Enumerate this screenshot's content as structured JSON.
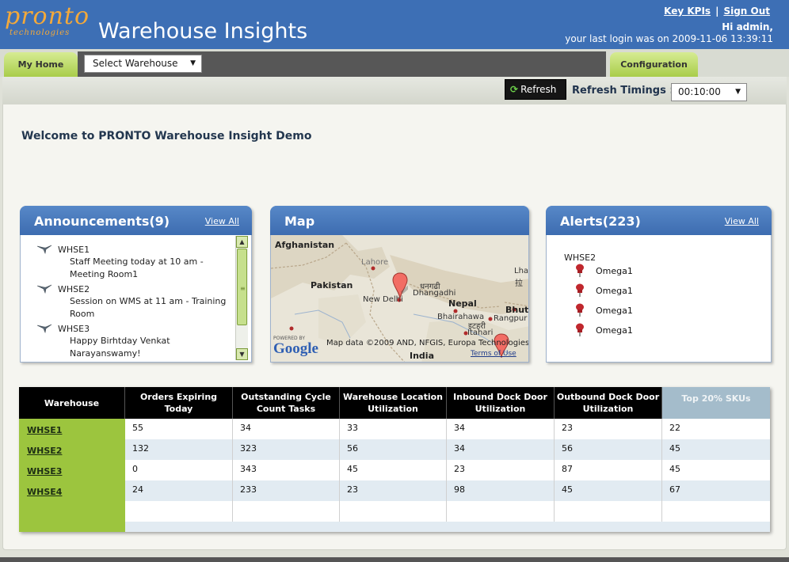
{
  "header": {
    "logo_text": "pronto",
    "logo_sub": "technologies",
    "title": "Warehouse Insights",
    "links": [
      "Key KPIs",
      "Sign Out"
    ],
    "greeting": "Hi admin,",
    "last_login": "your last login was on 2009-11-06 13:39:11",
    "brand_color": "#3d6fb5",
    "accent_color": "#f4a93a"
  },
  "nav": {
    "home_tab": "My Home",
    "warehouse_select": "Select Warehouse",
    "config_tab": "Configuration"
  },
  "toolbar": {
    "refresh_label": "Refresh",
    "refresh_timings_label": "Refresh Timings :",
    "refresh_timing_value": "00:10:00"
  },
  "welcome": "Welcome to PRONTO Warehouse Insight Demo",
  "announcements": {
    "title": "Announcements(9)",
    "view_all": "View All",
    "items": [
      {
        "warehouse": "WHSE1",
        "message": "Staff Meeting today at 10 am - Meeting Room1"
      },
      {
        "warehouse": "WHSE2",
        "message": "Session on WMS at 11 am - Training Room"
      },
      {
        "warehouse": "WHSE3",
        "message": "Happy Birhtday Venkat Narayanswamy!"
      }
    ]
  },
  "map": {
    "title": "Map",
    "labels": [
      "Afghanistan",
      "Pakistan",
      "Lahore",
      "New Delhi",
      "धनगढी",
      "Dhangadhi",
      "Nepal",
      "Bhairahawa",
      "इटहरी",
      "Itahari",
      "Rangpur",
      "Lha",
      "拉",
      "Bhutan",
      "India"
    ],
    "attribution": "Map data ©2009  AND, NFGIS, Europa Technologies",
    "powered_by": "POWERED BY",
    "google": "Google",
    "terms": "Terms of Use"
  },
  "alerts": {
    "title": "Alerts(223)",
    "view_all": "View All",
    "warehouse": "WHSE2",
    "items": [
      "Omega1",
      "Omega1",
      "Omega1",
      "Omega1"
    ]
  },
  "table": {
    "headers": [
      "Warehouse",
      "Orders Expiring Today",
      "Outstanding Cycle Count Tasks",
      "Warehouse Location Utilization",
      "Inbound Dock Door Utilization",
      "Outbound Dock Door Utilization",
      "Top 20% SKUs"
    ],
    "rows": [
      {
        "warehouse": "WHSE1",
        "values": [
          "55",
          "34",
          "33",
          "34",
          "23",
          "22"
        ]
      },
      {
        "warehouse": "WHSE2",
        "values": [
          "132",
          "323",
          "56",
          "34",
          "56",
          "45"
        ]
      },
      {
        "warehouse": "WHSE3",
        "values": [
          "0",
          "343",
          "45",
          "23",
          "87",
          "45"
        ]
      },
      {
        "warehouse": "WHSE4",
        "values": [
          "24",
          "233",
          "23",
          "98",
          "45",
          "67"
        ]
      }
    ]
  }
}
